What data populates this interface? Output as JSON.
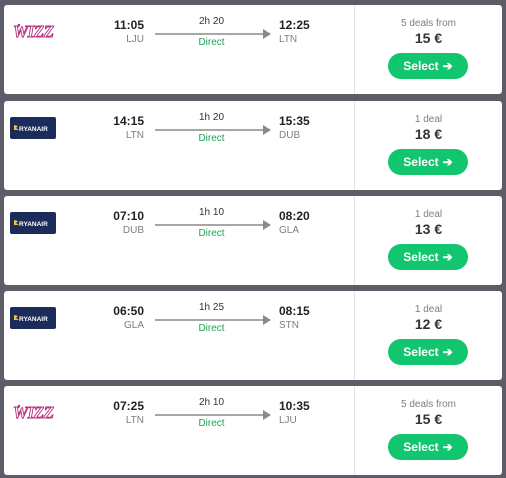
{
  "colors": {
    "background": "#5d5d69",
    "card": "#ffffff",
    "select_button": "#12c56f",
    "direct_text": "#21a05a",
    "wizz": "#b6307e",
    "ryanair_bg": "#1b2c5a",
    "ryanair_text": "#f3c433"
  },
  "flights": [
    {
      "airline": "Wizz Air",
      "logo_icon": "wizz-logo",
      "departure_time": "11:05",
      "departure_code": "LJU",
      "duration": "2h 20",
      "stops": "Direct",
      "arrival_time": "12:25",
      "arrival_code": "LTN",
      "deals": "5 deals from",
      "price": "15 €",
      "select_label": "Select"
    },
    {
      "airline": "Ryanair",
      "logo_icon": "ryanair-logo",
      "departure_time": "14:15",
      "departure_code": "LTN",
      "duration": "1h 20",
      "stops": "Direct",
      "arrival_time": "15:35",
      "arrival_code": "DUB",
      "deals": "1 deal",
      "price": "18 €",
      "select_label": "Select"
    },
    {
      "airline": "Ryanair",
      "logo_icon": "ryanair-logo",
      "departure_time": "07:10",
      "departure_code": "DUB",
      "duration": "1h 10",
      "stops": "Direct",
      "arrival_time": "08:20",
      "arrival_code": "GLA",
      "deals": "1 deal",
      "price": "13 €",
      "select_label": "Select"
    },
    {
      "airline": "Ryanair",
      "logo_icon": "ryanair-logo",
      "departure_time": "06:50",
      "departure_code": "GLA",
      "duration": "1h 25",
      "stops": "Direct",
      "arrival_time": "08:15",
      "arrival_code": "STN",
      "deals": "1 deal",
      "price": "12 €",
      "select_label": "Select"
    },
    {
      "airline": "Wizz Air",
      "logo_icon": "wizz-logo",
      "departure_time": "07:25",
      "departure_code": "LTN",
      "duration": "2h 10",
      "stops": "Direct",
      "arrival_time": "10:35",
      "arrival_code": "LJU",
      "deals": "5 deals from",
      "price": "15 €",
      "select_label": "Select"
    }
  ]
}
